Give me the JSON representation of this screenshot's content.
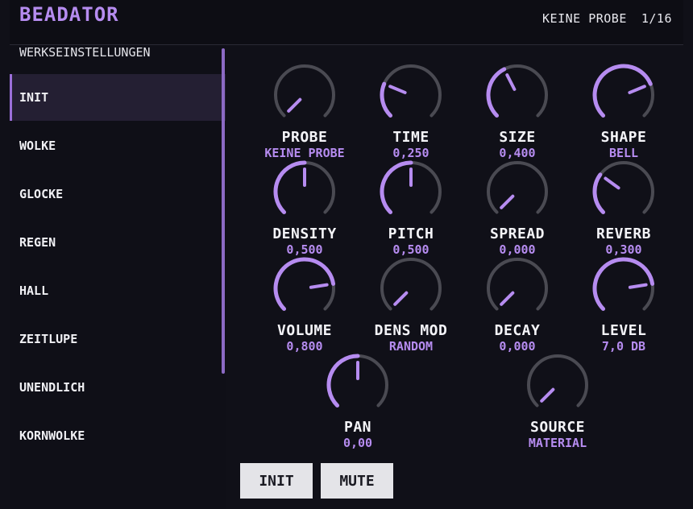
{
  "header": {
    "title": "BEADATOR",
    "sample_name": "KEINE PROBE",
    "page_indicator": "1/16"
  },
  "sidebar": {
    "section_title": "WERKSEINSTELLUNGEN",
    "items": [
      {
        "label": "INIT",
        "active": true
      },
      {
        "label": "WOLKE"
      },
      {
        "label": "GLOCKE"
      },
      {
        "label": "REGEN"
      },
      {
        "label": "HALL"
      },
      {
        "label": "ZEITLUPE"
      },
      {
        "label": "UNENDLICH"
      },
      {
        "label": "KORNWOLKE"
      }
    ]
  },
  "knobs": [
    {
      "label": "PROBE",
      "value": "KEINE PROBE",
      "level": 0.0
    },
    {
      "label": "TIME",
      "value": "0,250",
      "level": 0.25
    },
    {
      "label": "SIZE",
      "value": "0,400",
      "level": 0.4
    },
    {
      "label": "SHAPE",
      "value": "BELL",
      "level": 0.75
    },
    {
      "label": "DENSITY",
      "value": "0,500",
      "level": 0.5
    },
    {
      "label": "PITCH",
      "value": "0,500",
      "level": 0.5
    },
    {
      "label": "SPREAD",
      "value": "0,000",
      "level": 0.0
    },
    {
      "label": "REVERB",
      "value": "0,300",
      "level": 0.3
    },
    {
      "label": "VOLUME",
      "value": "0,800",
      "level": 0.8
    },
    {
      "label": "DENS MOD",
      "value": "RANDOM",
      "level": 0.0
    },
    {
      "label": "DECAY",
      "value": "0,000",
      "level": 0.0
    },
    {
      "label": "LEVEL",
      "value": "7,0 DB",
      "level": 0.8
    },
    {
      "label": "PAN",
      "value": "0,00",
      "level": 0.5
    },
    {
      "label": "SOURCE",
      "value": "MATERIAL",
      "level": 0.0
    }
  ],
  "buttons": {
    "init_label": "INIT",
    "mute_label": "MUTE"
  },
  "colors": {
    "accent": "#b68cf0",
    "track": "#4a4a52",
    "background": "#101018"
  }
}
